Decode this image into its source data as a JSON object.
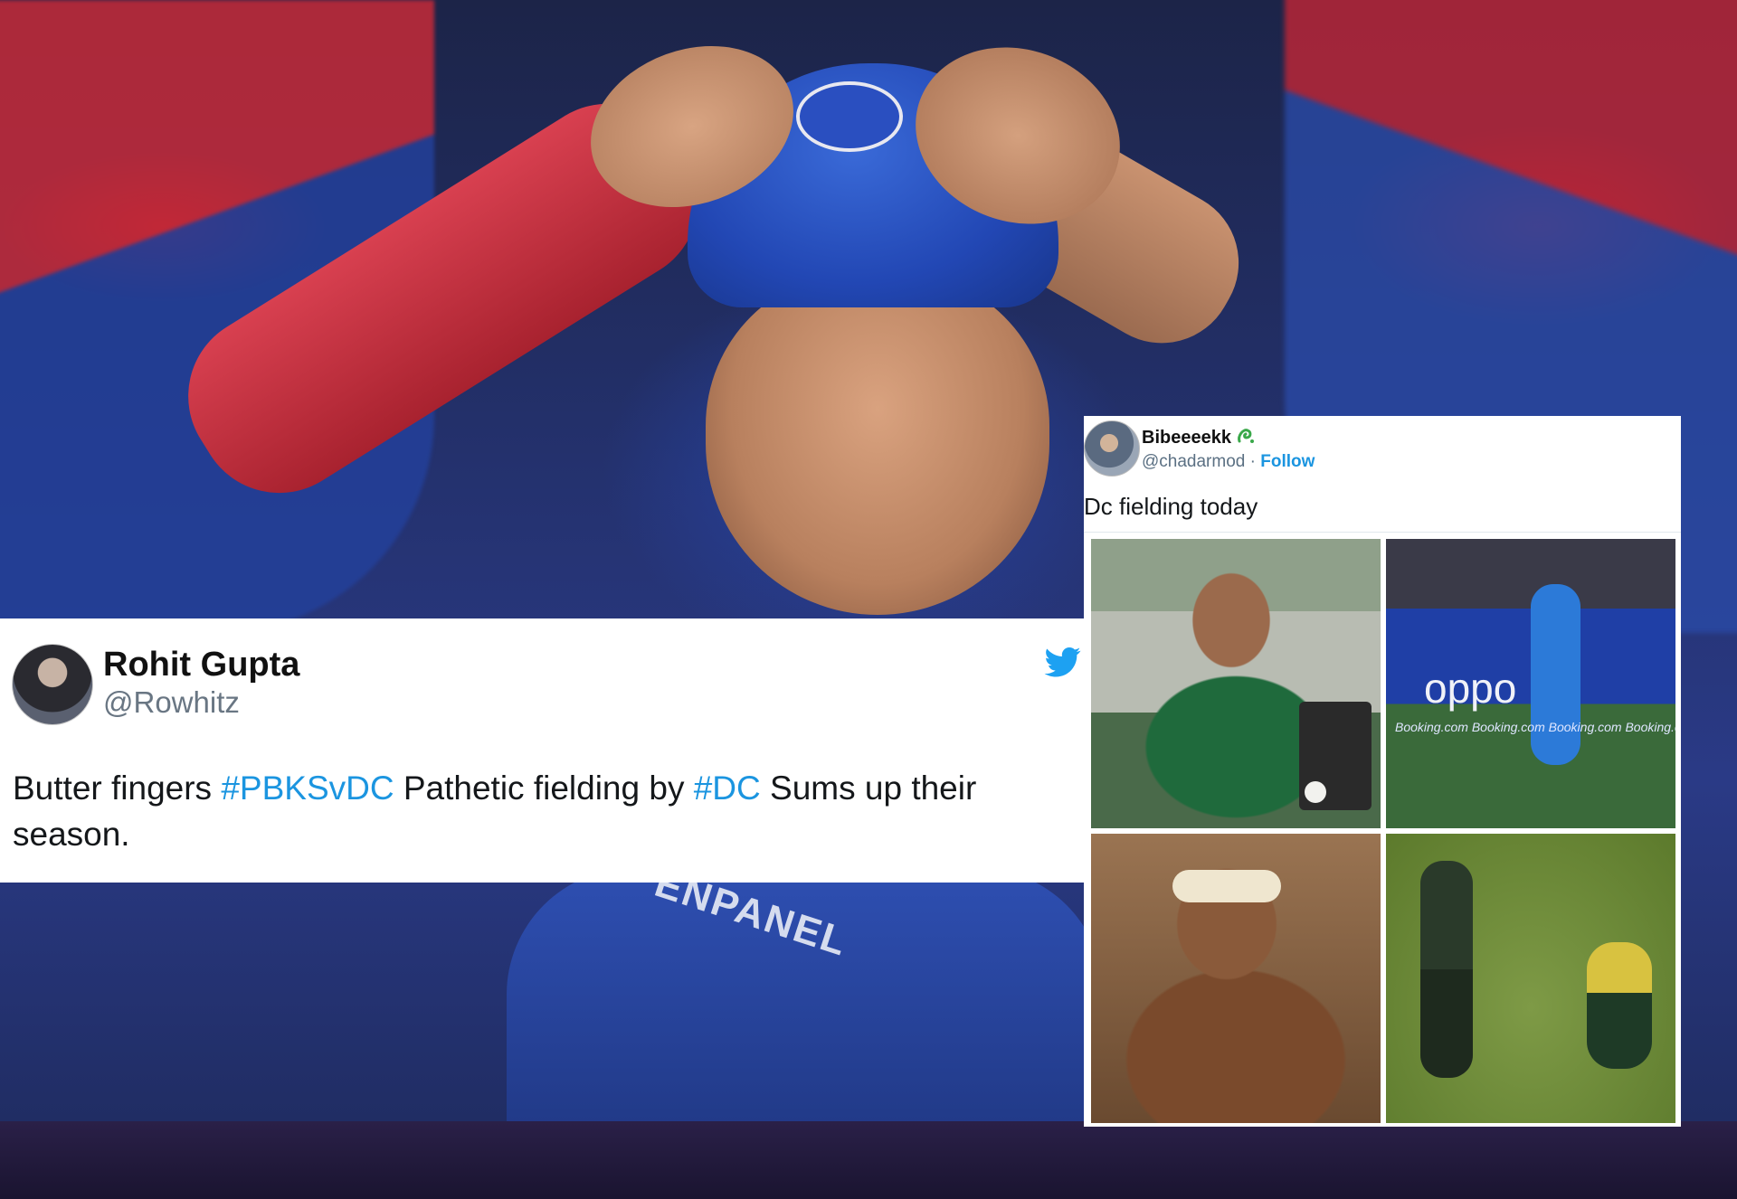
{
  "background": {
    "jersey_text": "ENPANEL"
  },
  "tweet1": {
    "name": "Rohit Gupta",
    "handle": "@Rowhitz",
    "text_parts": {
      "p1": "Butter fingers ",
      "h1": "#PBKSvDC",
      "p2": " Pathetic fielding by ",
      "h2": "#DC",
      "p3": " Sums up their season."
    },
    "icon": "twitter-bird-icon",
    "hashtag_color": "#1b95e0"
  },
  "tweet2": {
    "name": "Bibeeeekk",
    "handle": "@chadarmod",
    "separator": "·",
    "follow_label": "Follow",
    "text": "Dc fielding today",
    "images": {
      "img2_sponsor": "oppo",
      "img2_boards": "Booking.com   Booking.com   Booking.com   Booking.com"
    }
  },
  "colors": {
    "twitter_blue": "#1b95e0",
    "dc_blue": "#2247b4",
    "dc_red": "#c62a38"
  }
}
